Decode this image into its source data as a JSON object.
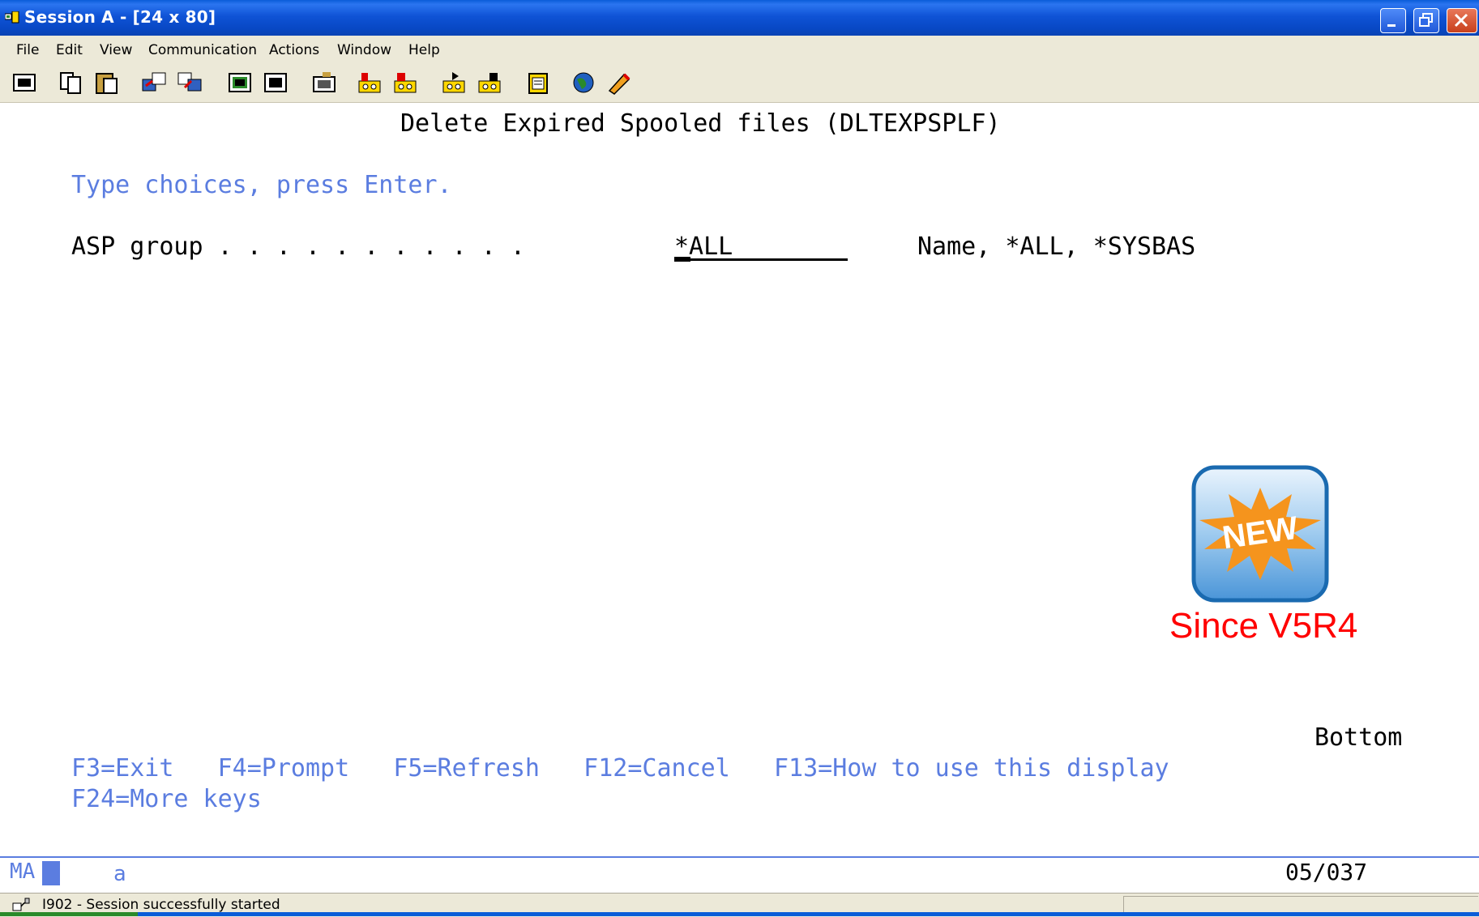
{
  "window": {
    "title": "Session A - [24 x 80]",
    "controls": [
      "minimize-icon",
      "restore-icon",
      "close-icon"
    ]
  },
  "menu": [
    {
      "label": "File"
    },
    {
      "label": "Edit"
    },
    {
      "label": "View"
    },
    {
      "label": "Communication"
    },
    {
      "label": "Actions"
    },
    {
      "label": "Window"
    },
    {
      "label": "Help"
    }
  ],
  "toolbar": {
    "icons": [
      "print-screen-icon",
      "copy-icon",
      "paste-icon",
      "send-file-icon",
      "receive-file-icon",
      "display-icon",
      "keyboard-icon",
      "macro-icon",
      "record-macro-icon",
      "stop-macro-icon",
      "play-macro-icon",
      "play-macro-2-icon",
      "clipboard-icon",
      "globe-icon",
      "edit-icon"
    ]
  },
  "screen": {
    "heading": "Delete Expired Spooled files (DLTEXPSPLF)",
    "instruction": "Type choices, press Enter.",
    "field": {
      "label": "ASP group . . . . . . . . . . .",
      "value": "*ALL",
      "hint": "Name, *ALL, *SYSBAS"
    },
    "position": "Bottom",
    "fkeys_line1": "F3=Exit   F4=Prompt   F5=Refresh   F12=Cancel   F13=How to use this display",
    "fkeys_line2": "F24=More keys"
  },
  "badge": {
    "text": "NEW",
    "caption": "Since V5R4",
    "caption_color": "#ff0000",
    "burst_color": "#f5941d"
  },
  "oia": {
    "indicator": "MA",
    "mode": "a",
    "cursor_pos": "05/037"
  },
  "status": {
    "message": "I902 - Session successfully started"
  },
  "colors": {
    "titlebar": "#0a5cd8",
    "field_text": "#5b7de0",
    "chrome": "#ece9d8"
  }
}
